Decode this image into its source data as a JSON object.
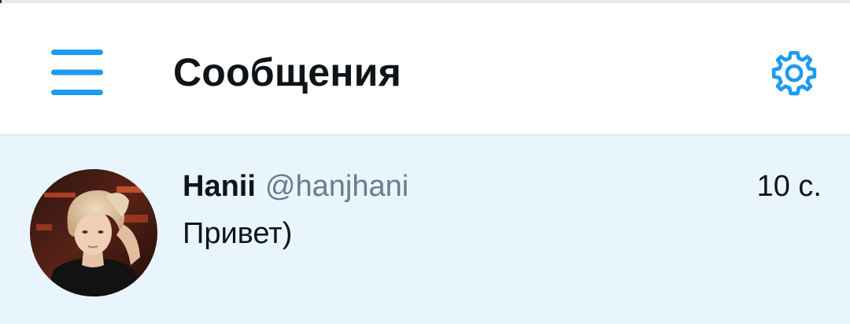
{
  "header": {
    "title": "Сообщения",
    "menu_icon": "hamburger-menu-icon",
    "settings_icon": "gear-icon"
  },
  "conversations": [
    {
      "name": "Hanii",
      "handle": "@hanjhani",
      "time": "10 с.",
      "preview": "Привет)"
    }
  ],
  "colors": {
    "accent": "#1d9bf0",
    "selected_row": "#e8f5fd",
    "text_primary": "#0f1419",
    "text_secondary": "#6b7c8a"
  }
}
